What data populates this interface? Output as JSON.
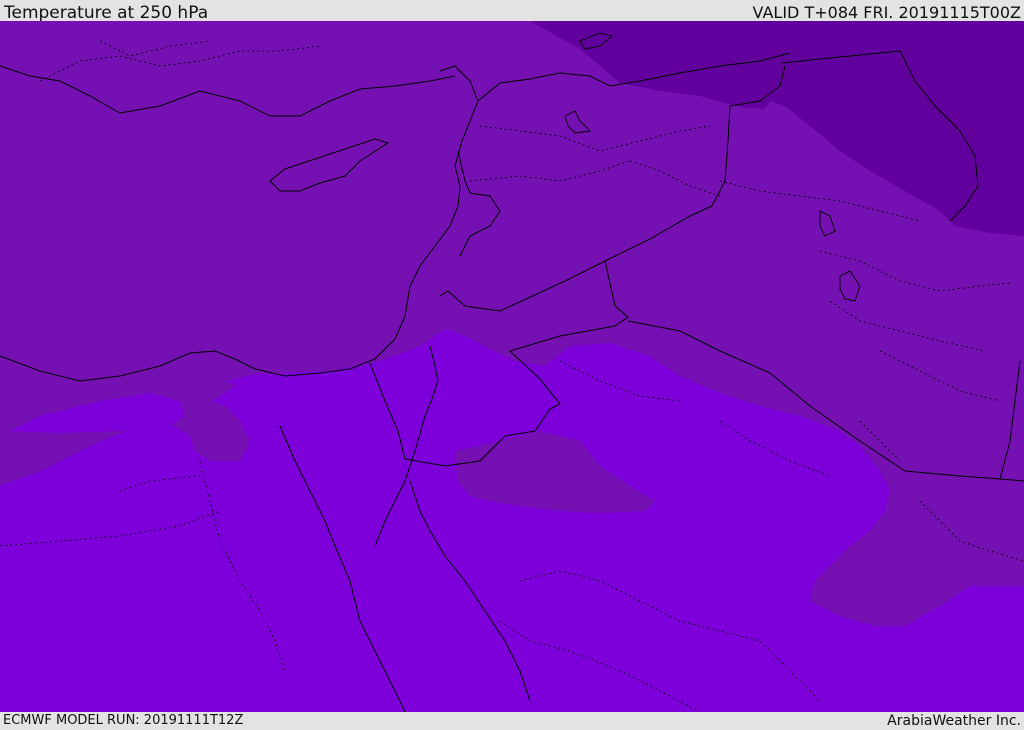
{
  "header": {
    "title": "Temperature at 250 hPa",
    "valid": "VALID T+084 FRI. 20191115T00Z"
  },
  "footer": {
    "model_run": "ECMWF MODEL RUN: 20191111T12Z",
    "credit": "ArabiaWeather Inc."
  },
  "map": {
    "field": "temperature",
    "level": "250 hPa",
    "colors": {
      "band_dark": "#62009e",
      "band_mid": "#7510b2",
      "band_light": "#7d00da",
      "coastline": "#000000",
      "border": "#000000"
    }
  }
}
